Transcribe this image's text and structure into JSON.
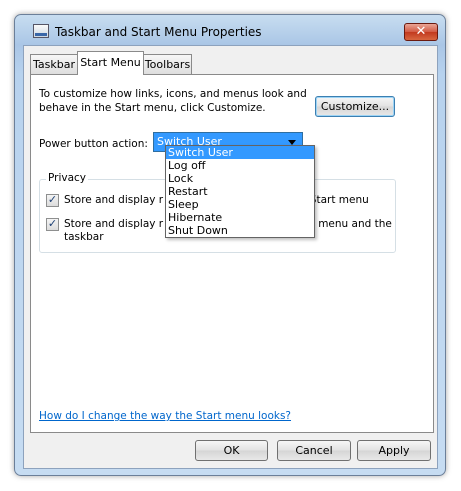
{
  "window": {
    "title": "Taskbar and Start Menu Properties",
    "close_glyph": "✕",
    "accent": "#3399ff"
  },
  "tabs": [
    {
      "label": "Taskbar",
      "active": false
    },
    {
      "label": "Start Menu",
      "active": true
    },
    {
      "label": "Toolbars",
      "active": false
    }
  ],
  "start_menu": {
    "intro_text": "To customize how links, icons, and menus look and behave in the Start menu, click Customize.",
    "customize_label": "Customize...",
    "power_label": "Power button action:",
    "power_value": "Switch User",
    "power_options": [
      "Switch User",
      "Log off",
      "Lock",
      "Restart",
      "Sleep",
      "Hibernate",
      "Shut Down"
    ],
    "privacy": {
      "title": "Privacy",
      "items": [
        {
          "left": "Store and display r",
          "right": "e Start menu",
          "checked": true
        },
        {
          "left": "Store and display r",
          "right": "art menu and the",
          "continuation": "taskbar",
          "checked": true
        }
      ]
    },
    "help_link": "How do I change the way the Start menu looks?"
  },
  "footer": {
    "ok_label": "OK",
    "cancel_label": "Cancel",
    "apply_label": "Apply"
  }
}
